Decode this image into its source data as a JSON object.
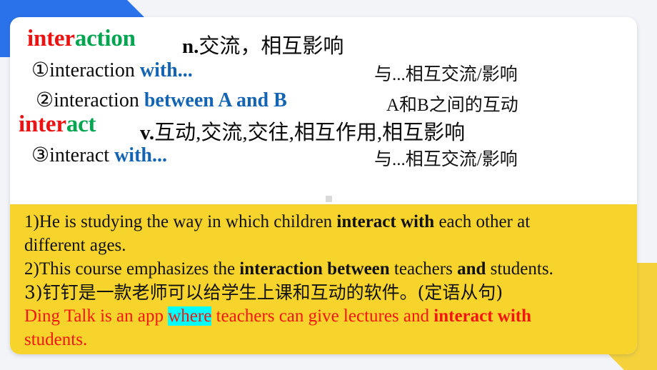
{
  "colors": {
    "deco_blue": "#2a72ea",
    "deco_yellow": "#f5d23c",
    "example_block": "#f7d42c",
    "card": "#ffffff",
    "background": "#f2f4f8",
    "word_red": "#ee1111",
    "word_green": "#00a550",
    "phrase_blue": "#1464b4",
    "sentence_red": "#f5150f",
    "highlight_cyan": "#00ffff"
  },
  "definitions": {
    "entry1": {
      "headword_part1": "inter",
      "headword_part2": "action",
      "pos": "n.",
      "meaning_cn": "交流，相互影响"
    },
    "usage1": {
      "number": "①",
      "text": "interaction ",
      "keyword": "with...",
      "gloss_cn": "与...相互交流/影响"
    },
    "usage2": {
      "number": "②",
      "text": "interaction ",
      "keyword": "between A and B",
      "gloss_cn": "A和B之间的互动"
    },
    "entry2": {
      "headword_part1": "inter",
      "headword_part2": "act",
      "pos": "v.",
      "meaning_cn": "互动,交流,交往,相互作用,相互影响"
    },
    "usage3": {
      "number": "③",
      "text": "interact ",
      "keyword": "with...",
      "gloss_cn": "与...相互交流/影响"
    }
  },
  "examples": {
    "sentence1": {
      "prefix": "1)He is studying the way in which children ",
      "bold": "interact with",
      "suffix": " each other at",
      "line2": "different ages."
    },
    "sentence2": {
      "prefix": "2)This course emphasizes the ",
      "bold1": "interaction between",
      "middle": " teachers ",
      "bold2": "and",
      "suffix": " students."
    },
    "sentence3": {
      "chinese": "3)钉钉是一款老师可以给学生上课和互动的软件。(定语从句)",
      "english_prefix": "Ding Talk is an app ",
      "highlight": "where",
      "english_middle": " teachers can give lectures and ",
      "english_bold": "interact with",
      "english_line2": "students."
    }
  }
}
